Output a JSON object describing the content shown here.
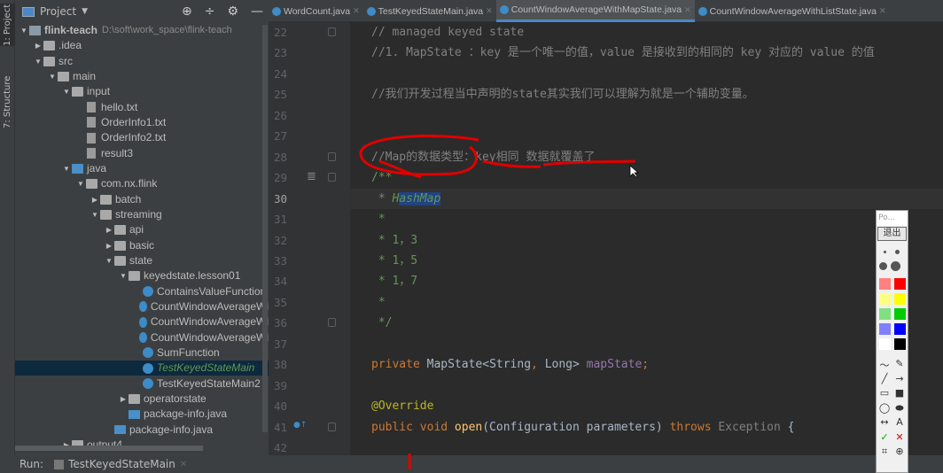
{
  "stripe": {
    "project_tab": "1: Project",
    "structure_tab": "7: Structure"
  },
  "panel": {
    "title": "Project",
    "tools": [
      "locate-icon",
      "collapse-icon",
      "gear-icon",
      "minimize-icon"
    ]
  },
  "tree": [
    {
      "label": "flink-teach",
      "path": "D:\\soft\\work_space\\flink-teach",
      "depth": 0,
      "arrow": "down",
      "icon": "proj"
    },
    {
      "label": ".idea",
      "depth": 1,
      "arrow": "right",
      "icon": "folder"
    },
    {
      "label": "src",
      "depth": 1,
      "arrow": "down",
      "icon": "folder"
    },
    {
      "label": "main",
      "depth": 2,
      "arrow": "down",
      "icon": "folder"
    },
    {
      "label": "input",
      "depth": 3,
      "arrow": "down",
      "icon": "folder"
    },
    {
      "label": "hello.txt",
      "depth": 4,
      "icon": "file"
    },
    {
      "label": "OrderInfo1.txt",
      "depth": 4,
      "icon": "file"
    },
    {
      "label": "OrderInfo2.txt",
      "depth": 4,
      "icon": "file"
    },
    {
      "label": "result3",
      "depth": 4,
      "icon": "file"
    },
    {
      "label": "java",
      "depth": 3,
      "arrow": "down",
      "icon": "folder blue"
    },
    {
      "label": "com.nx.flink",
      "depth": 4,
      "arrow": "down",
      "icon": "pkg"
    },
    {
      "label": "batch",
      "depth": 5,
      "arrow": "right",
      "icon": "pkg"
    },
    {
      "label": "streaming",
      "depth": 5,
      "arrow": "down",
      "icon": "pkg"
    },
    {
      "label": "api",
      "depth": 6,
      "arrow": "right",
      "icon": "pkg"
    },
    {
      "label": "basic",
      "depth": 6,
      "arrow": "right",
      "icon": "pkg"
    },
    {
      "label": "state",
      "depth": 6,
      "arrow": "down",
      "icon": "pkg"
    },
    {
      "label": "keyedstate.lesson01",
      "depth": 7,
      "arrow": "down",
      "icon": "pkg"
    },
    {
      "label": "ContainsValueFunction",
      "depth": 8,
      "icon": "class"
    },
    {
      "label": "CountWindowAverageWi",
      "depth": 8,
      "icon": "class"
    },
    {
      "label": "CountWindowAverageWi",
      "depth": 8,
      "icon": "class"
    },
    {
      "label": "CountWindowAverageWi",
      "depth": 8,
      "icon": "class"
    },
    {
      "label": "SumFunction",
      "depth": 8,
      "icon": "class"
    },
    {
      "label": "TestKeyedStateMain",
      "depth": 8,
      "icon": "class",
      "selected": true
    },
    {
      "label": "TestKeyedStateMain2",
      "depth": 8,
      "icon": "class"
    },
    {
      "label": "operatorstate",
      "depth": 7,
      "arrow": "right",
      "icon": "pkg"
    },
    {
      "label": "package-info.java",
      "depth": 7,
      "icon": "pinfo"
    },
    {
      "label": "package-info.java",
      "depth": 6,
      "icon": "pinfo"
    },
    {
      "label": "output4",
      "depth": 3,
      "arrow": "right",
      "icon": "folder"
    }
  ],
  "tabs": [
    {
      "label": "WordCount.java"
    },
    {
      "label": "TestKeyedStateMain.java"
    },
    {
      "label": "CountWindowAverageWithMapState.java",
      "active": true
    },
    {
      "label": "CountWindowAverageWithListState.java"
    }
  ],
  "code": {
    "current_line": 30,
    "lines": [
      {
        "n": 22,
        "tokens": [
          {
            "t": "// managed keyed state",
            "c": "cm"
          }
        ]
      },
      {
        "n": 23,
        "tokens": [
          {
            "t": "//1. MapState ：key 是一个唯一的值，value 是接收到的相同的 key 对应的 value 的值",
            "c": "cm"
          }
        ]
      },
      {
        "n": 24,
        "tokens": []
      },
      {
        "n": 25,
        "tokens": [
          {
            "t": "//我们开发过程当中声明的state其实我们可以理解为就是一个辅助变量。",
            "c": "cm"
          }
        ]
      },
      {
        "n": 26,
        "tokens": []
      },
      {
        "n": 27,
        "tokens": []
      },
      {
        "n": 28,
        "tokens": [
          {
            "t": "//Map的数据类型：key相同 数据就覆盖了",
            "c": "cm"
          }
        ]
      },
      {
        "n": 29,
        "tokens": [
          {
            "t": "/**",
            "c": "doc"
          }
        ]
      },
      {
        "n": 30,
        "tokens": [
          {
            "t": " * ",
            "c": "cm"
          },
          {
            "t": "H",
            "c": "dtag"
          },
          {
            "t": "ashMap",
            "c": "sel"
          }
        ]
      },
      {
        "n": 31,
        "tokens": [
          {
            "t": " *",
            "c": "doc"
          }
        ]
      },
      {
        "n": 32,
        "tokens": [
          {
            "t": " * 1，3",
            "c": "doc"
          }
        ]
      },
      {
        "n": 33,
        "tokens": [
          {
            "t": " * 1，5",
            "c": "doc"
          }
        ]
      },
      {
        "n": 34,
        "tokens": [
          {
            "t": " * 1，7",
            "c": "doc"
          }
        ]
      },
      {
        "n": 35,
        "tokens": [
          {
            "t": " *",
            "c": "doc"
          }
        ]
      },
      {
        "n": 36,
        "tokens": [
          {
            "t": " */",
            "c": "doc"
          }
        ]
      },
      {
        "n": 37,
        "tokens": []
      },
      {
        "n": 38,
        "tokens": [
          {
            "t": "private ",
            "c": "kw"
          },
          {
            "t": "MapState<String",
            "c": ""
          },
          {
            "t": ", ",
            "c": "kw"
          },
          {
            "t": "Long> ",
            "c": ""
          },
          {
            "t": "mapState",
            "c": "fld"
          },
          {
            "t": ";",
            "c": "kw"
          }
        ]
      },
      {
        "n": 39,
        "tokens": []
      },
      {
        "n": 40,
        "tokens": [
          {
            "t": "@Override",
            "c": "an"
          }
        ]
      },
      {
        "n": 41,
        "tokens": [
          {
            "t": "public void ",
            "c": "kw"
          },
          {
            "t": "open",
            "c": "fn"
          },
          {
            "t": "(Configuration parameters) ",
            "c": ""
          },
          {
            "t": "throws ",
            "c": "kw"
          },
          {
            "t": "Exception ",
            "c": "exc"
          },
          {
            "t": "{",
            "c": ""
          }
        ]
      },
      {
        "n": 42,
        "tokens": []
      }
    ]
  },
  "run": {
    "label": "Run:",
    "config": "TestKeyedStateMain"
  },
  "pen_toolbar": {
    "title": "Po...",
    "exit": "退出",
    "colors": [
      "#ff8080",
      "#ff0000",
      "#ffff80",
      "#ffff00",
      "#80e080",
      "#00cc00",
      "#8080ff",
      "#0000ff",
      "#ffffff",
      "#000000"
    ],
    "tools": [
      "～",
      "✎",
      "╱",
      "→",
      "▭",
      "■",
      "◯",
      "⬬",
      "↔",
      "A",
      "✓",
      "✕",
      "⌗",
      "⊕"
    ]
  },
  "annotation_color": "#e00000"
}
